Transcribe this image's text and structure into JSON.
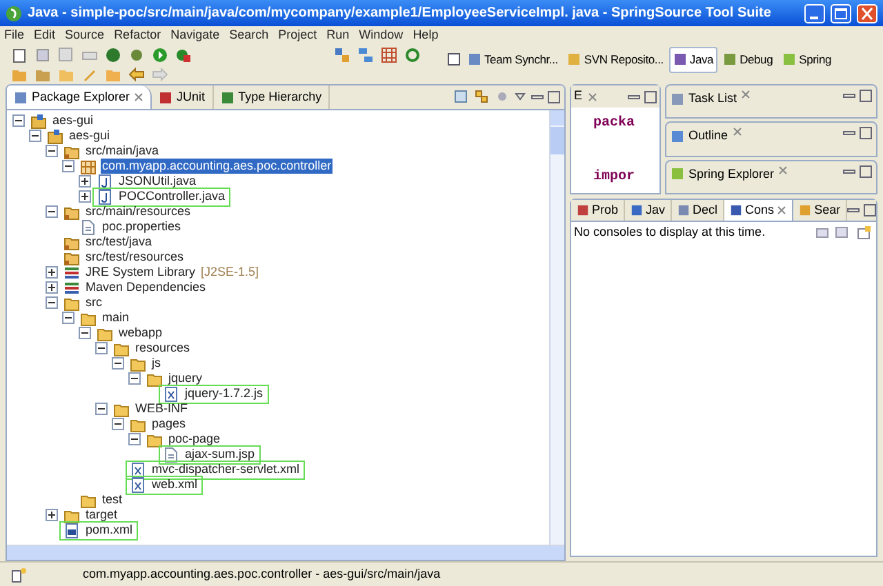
{
  "window": {
    "title": "Java - simple-poc/src/main/java/com/mycompany/example1/EmployeeServiceImpl. java - SpringSource Tool Suite"
  },
  "menu": [
    "File",
    "Edit",
    "Source",
    "Refactor",
    "Navigate",
    "Search",
    "Project",
    "Run",
    "Window",
    "Help"
  ],
  "perspectives": [
    {
      "label": "Team Synchr...",
      "selected": false
    },
    {
      "label": "SVN Reposito...",
      "selected": false
    },
    {
      "label": "Java",
      "selected": true
    },
    {
      "label": "Debug",
      "selected": false
    },
    {
      "label": "Spring",
      "selected": false
    }
  ],
  "package_explorer": {
    "tabs": [
      {
        "label": "Package Explorer",
        "selected": true
      },
      {
        "label": "JUnit",
        "selected": false
      },
      {
        "label": "Type Hierarchy",
        "selected": false
      }
    ],
    "tree": [
      {
        "label": "aes-gui",
        "kind": "project",
        "expanded": true,
        "children": [
          {
            "label": "aes-gui",
            "kind": "project",
            "expanded": true,
            "children": [
              {
                "label": "src/main/java",
                "kind": "source",
                "expanded": true,
                "children": [
                  {
                    "label": "com.myapp.accounting.aes.poc.controller",
                    "kind": "package",
                    "expanded": true,
                    "selected": true,
                    "children": [
                      {
                        "label": "JSONUtil.java",
                        "kind": "java",
                        "expanded": false
                      },
                      {
                        "label": "POCController.java",
                        "kind": "java",
                        "expanded": false,
                        "highlighted": true
                      }
                    ]
                  }
                ]
              },
              {
                "label": "src/main/resources",
                "kind": "source",
                "expanded": true,
                "children": [
                  {
                    "label": "poc.properties",
                    "kind": "file"
                  }
                ]
              },
              {
                "label": "src/test/java",
                "kind": "source"
              },
              {
                "label": "src/test/resources",
                "kind": "source"
              },
              {
                "label": "JRE System Library",
                "suffix": "[J2SE-1.5]",
                "kind": "library",
                "expanded": false
              },
              {
                "label": "Maven Dependencies",
                "kind": "library",
                "expanded": false
              },
              {
                "label": "src",
                "kind": "folder",
                "expanded": true,
                "children": [
                  {
                    "label": "main",
                    "kind": "folder",
                    "expanded": true,
                    "children": [
                      {
                        "label": "webapp",
                        "kind": "folder",
                        "expanded": true,
                        "children": [
                          {
                            "label": "resources",
                            "kind": "folder",
                            "expanded": true,
                            "children": [
                              {
                                "label": "js",
                                "kind": "folder",
                                "expanded": true,
                                "children": [
                                  {
                                    "label": "jquery",
                                    "kind": "folder",
                                    "expanded": true,
                                    "children": [
                                      {
                                        "label": "jquery-1.7.2.js",
                                        "kind": "script",
                                        "highlighted": true
                                      }
                                    ]
                                  }
                                ]
                              }
                            ]
                          },
                          {
                            "label": "WEB-INF",
                            "kind": "folder",
                            "expanded": true,
                            "children": [
                              {
                                "label": "pages",
                                "kind": "folder",
                                "expanded": true,
                                "children": [
                                  {
                                    "label": "poc-page",
                                    "kind": "folder",
                                    "expanded": true,
                                    "children": [
                                      {
                                        "label": "ajax-sum.jsp",
                                        "kind": "file",
                                        "highlighted": true
                                      }
                                    ]
                                  }
                                ]
                              },
                              {
                                "label": "mvc-dispatcher-servlet.xml",
                                "kind": "xml",
                                "highlighted": true
                              },
                              {
                                "label": "web.xml",
                                "kind": "xml",
                                "highlighted": true
                              }
                            ]
                          }
                        ]
                      }
                    ]
                  },
                  {
                    "label": "test",
                    "kind": "folder"
                  }
                ]
              },
              {
                "label": "target",
                "kind": "folder",
                "expanded": false
              },
              {
                "label": "pom.xml",
                "kind": "pom",
                "highlighted": true
              }
            ]
          }
        ]
      }
    ]
  },
  "editor": {
    "tab": "E",
    "lines": [
      "packa",
      "impor"
    ]
  },
  "side_views": [
    {
      "label": "Task List"
    },
    {
      "label": "Outline"
    },
    {
      "label": "Spring Explorer"
    }
  ],
  "console": {
    "tabs": [
      {
        "label": "Prob",
        "selected": false
      },
      {
        "label": "Jav",
        "selected": false
      },
      {
        "label": "Decl",
        "selected": false
      },
      {
        "label": "Cons",
        "selected": true
      },
      {
        "label": "Sear",
        "selected": false
      }
    ],
    "message": "No consoles to display at this time."
  },
  "status_bar": "com.myapp.accounting.aes.poc.controller - aes-gui/src/main/java"
}
